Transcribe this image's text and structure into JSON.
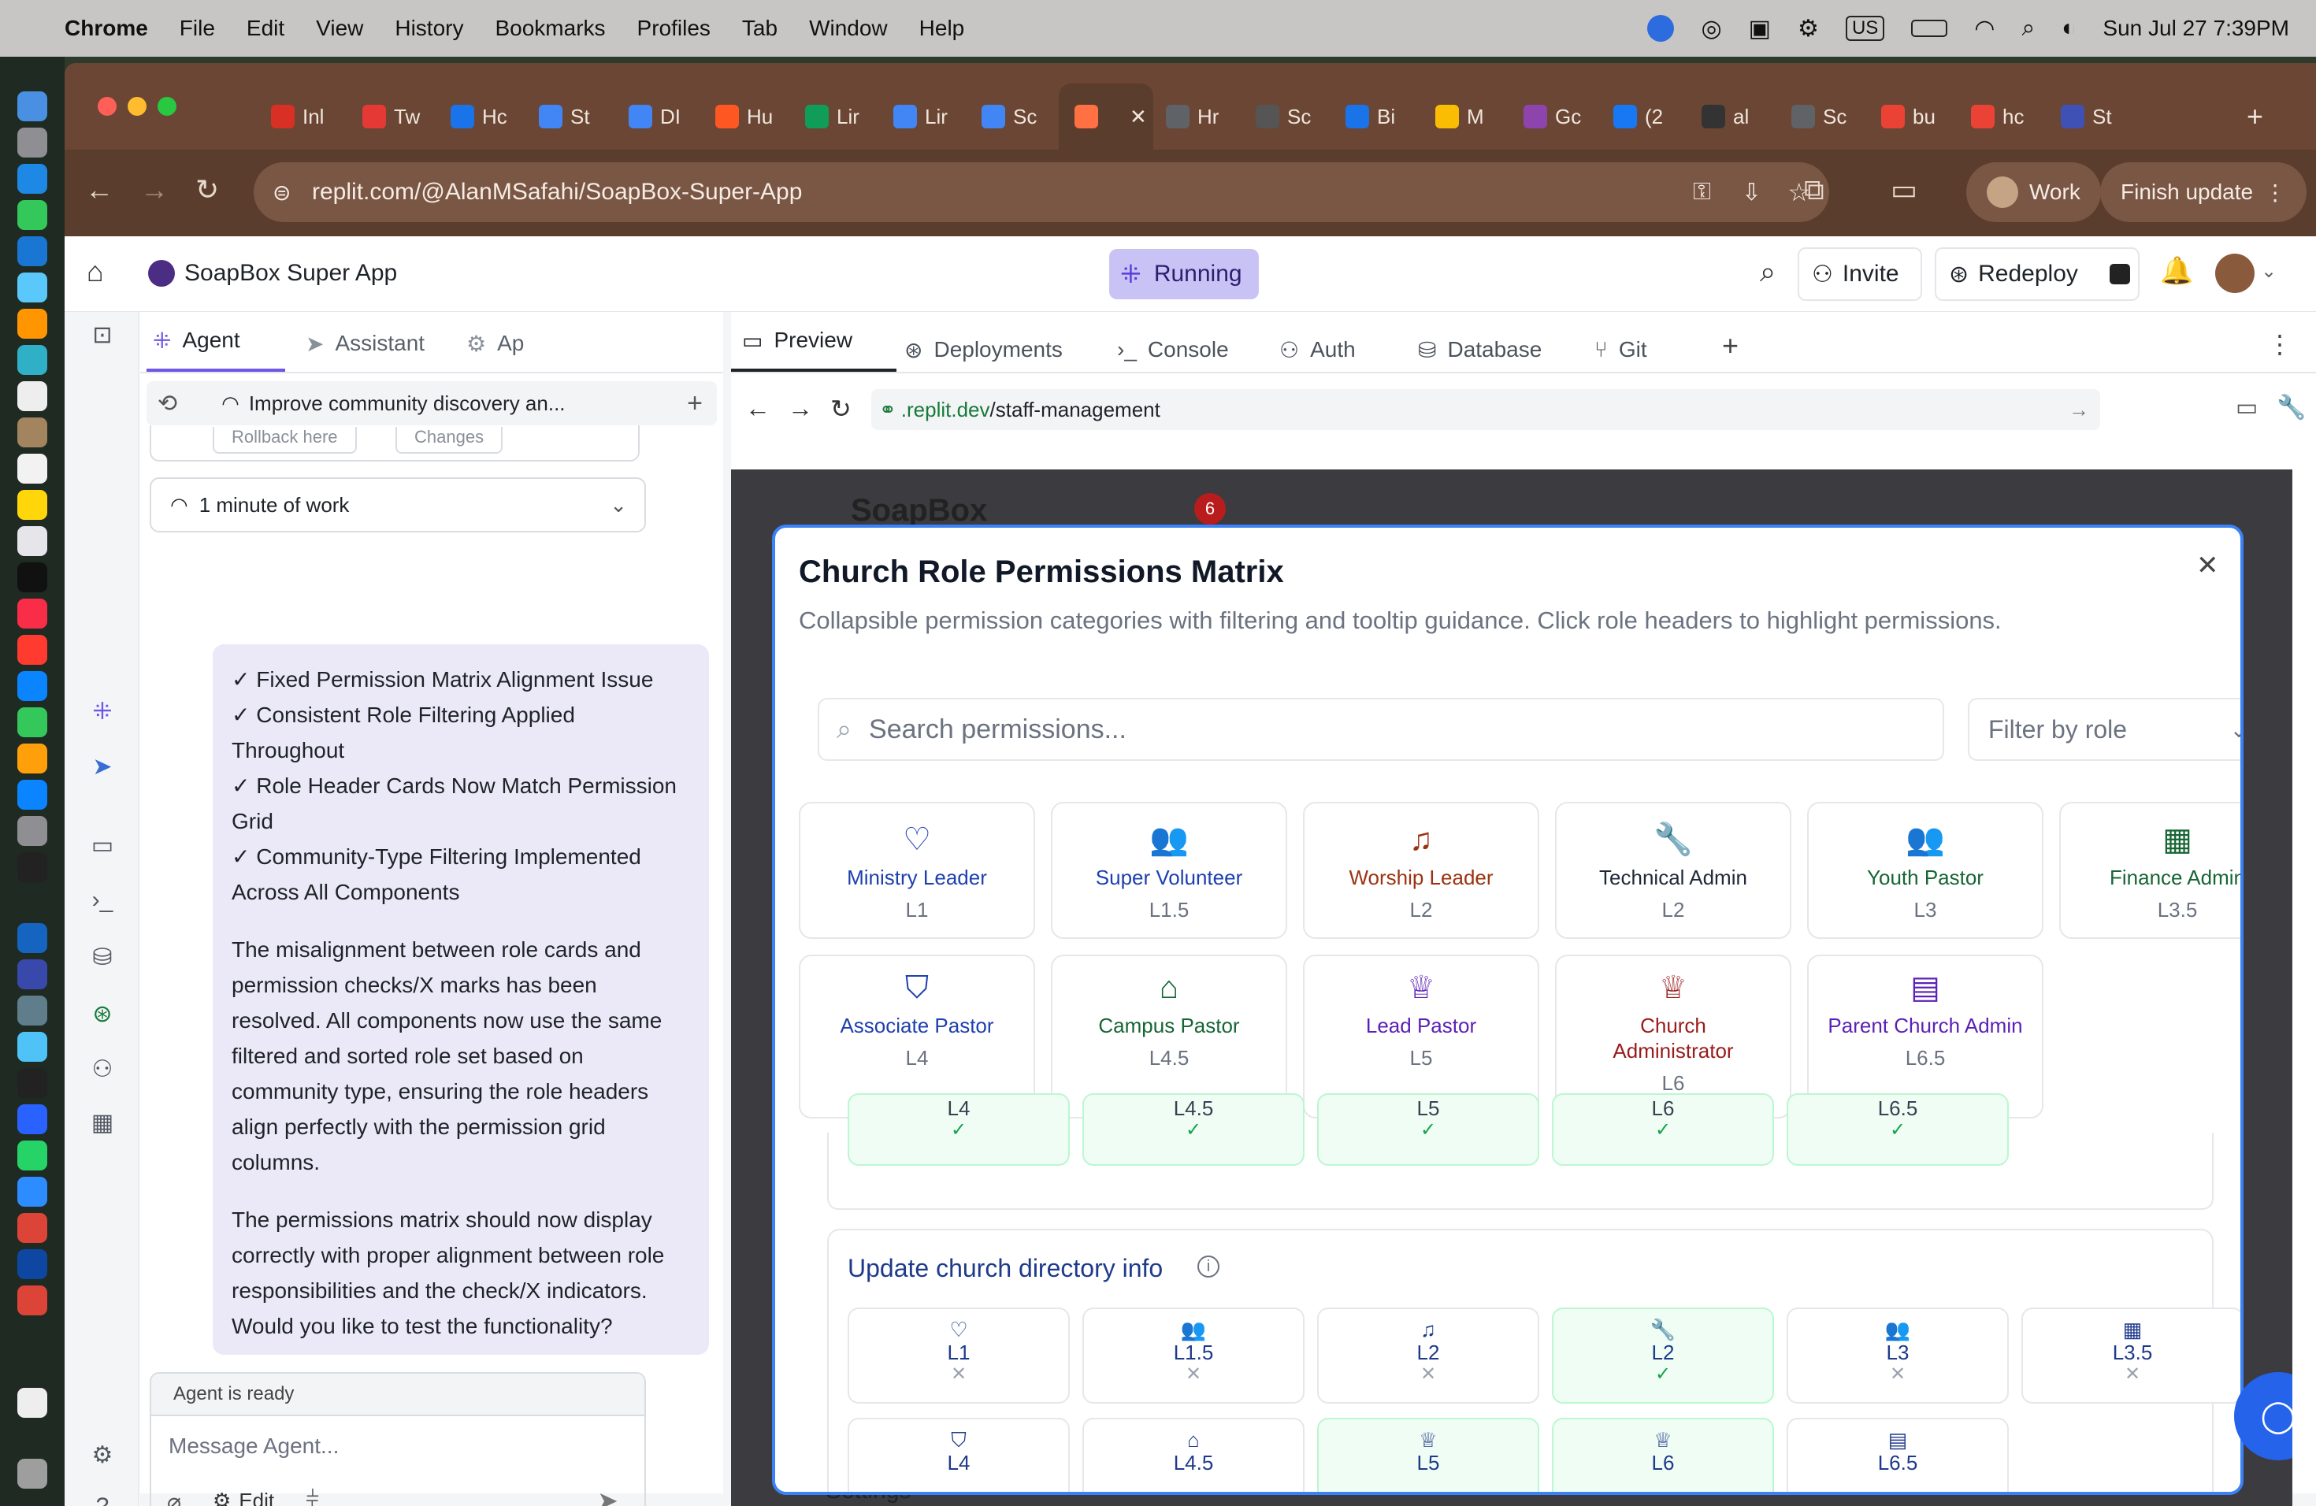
{
  "menubar": {
    "app": "Chrome",
    "items": [
      "File",
      "Edit",
      "View",
      "History",
      "Bookmarks",
      "Profiles",
      "Tab",
      "Window",
      "Help"
    ],
    "status": {
      "input": "US",
      "datetime": "Sun Jul 27  7:39PM"
    }
  },
  "browser": {
    "tabs": [
      "Inl",
      "Tw",
      "Hc",
      "St",
      "DI",
      "Hu",
      "Lir",
      "Lir",
      "Sc",
      "",
      "Hr",
      "Sc",
      "Bi",
      "M",
      "Gc",
      "(2",
      "al",
      "Sc",
      "bu",
      "hc",
      "St"
    ],
    "url": "replit.com/@AlanMSafahi/SoapBox-Super-App",
    "profile": "Work",
    "update": "Finish update"
  },
  "replit": {
    "project": "SoapBox Super App",
    "status": "Running",
    "invite": "Invite",
    "redeploy": "Redeploy",
    "left_tabs": [
      "Agent",
      "Assistant",
      "Ap"
    ],
    "checkpoint": "Improve community discovery an...",
    "rollback": "Rollback here",
    "changes": "Changes",
    "work_time": "1 minute of work",
    "agent_message": {
      "items": [
        "✓ Fixed Permission Matrix Alignment Issue",
        "✓ Consistent Role Filtering Applied Throughout",
        "✓ Role Header Cards Now Match Permission Grid",
        "✓ Community-Type Filtering Implemented Across All Components"
      ],
      "para1": "The misalignment between role cards and permission checks/X marks has been resolved. All components now use the same filtered and sorted role set based on community type, ensuring the role headers align perfectly with the permission grid columns.",
      "para2": "The permissions matrix should now display correctly with proper alignment between role responsibilities and the check/X indicators. Would you like to test the functionality?"
    },
    "agent_status": "Agent is ready",
    "message_placeholder": "Message Agent...",
    "edit_label": "Edit",
    "right_tabs": [
      "Preview",
      "Deployments",
      "Console",
      "Auth",
      "Database",
      "Git"
    ],
    "preview_url_domain": ".replit.dev",
    "preview_url_path": "/staff-management",
    "bg_logo": "SoapBox",
    "bg_badge": "6",
    "bg_settings": "Settings"
  },
  "modal": {
    "title": "Church Role Permissions Matrix",
    "subtitle": "Collapsible permission categories with filtering and tooltip guidance. Click role headers to highlight permissions.",
    "search_placeholder": "Search permissions...",
    "filter_placeholder": "Filter by role",
    "roles": [
      {
        "name": "Ministry Leader",
        "level": "L1",
        "icon": "heart-icon",
        "color": "#1e40af"
      },
      {
        "name": "Super Volunteer",
        "level": "L1.5",
        "icon": "users-icon",
        "color": "#1e40af"
      },
      {
        "name": "Worship Leader",
        "level": "L2",
        "icon": "music-icon",
        "color": "#9a3412"
      },
      {
        "name": "Technical Admin",
        "level": "L2",
        "icon": "wrench-icon",
        "color": "#1f2937"
      },
      {
        "name": "Youth Pastor",
        "level": "L3",
        "icon": "users-icon",
        "color": "#166534"
      },
      {
        "name": "Finance Admin",
        "level": "L3.5",
        "icon": "calculator-icon",
        "color": "#166534"
      },
      {
        "name": "Associate Pastor",
        "level": "L4",
        "icon": "shield-icon",
        "color": "#1e40af"
      },
      {
        "name": "Campus Pastor",
        "level": "L4.5",
        "icon": "church-icon",
        "color": "#166534"
      },
      {
        "name": "Lead Pastor",
        "level": "L5",
        "icon": "crown-icon",
        "color": "#5b21b6"
      },
      {
        "name": "Church Administrator",
        "level": "L6",
        "icon": "crown-icon",
        "color": "#991b1b"
      },
      {
        "name": "Parent Church Admin",
        "level": "L6.5",
        "icon": "building-icon",
        "color": "#5b21b6"
      }
    ],
    "partial_row": [
      {
        "level": "L4",
        "mark": "✓"
      },
      {
        "level": "L4.5",
        "mark": "✓"
      },
      {
        "level": "L5",
        "mark": "✓"
      },
      {
        "level": "L6",
        "mark": "✓"
      },
      {
        "level": "L6.5",
        "mark": "✓"
      }
    ],
    "section_title": "Update church directory info",
    "section_cells": [
      {
        "level": "L1",
        "mark": "✕",
        "ok": false,
        "icon": "♡"
      },
      {
        "level": "L1.5",
        "mark": "✕",
        "ok": false,
        "icon": "👥"
      },
      {
        "level": "L2",
        "mark": "✕",
        "ok": false,
        "icon": "♫"
      },
      {
        "level": "L2",
        "mark": "✓",
        "ok": true,
        "icon": "🔧"
      },
      {
        "level": "L3",
        "mark": "✕",
        "ok": false,
        "icon": "👥"
      },
      {
        "level": "L3.5",
        "mark": "✕",
        "ok": false,
        "icon": "▦"
      },
      {
        "level": "L4",
        "mark": "",
        "ok": false,
        "icon": "⛉"
      },
      {
        "level": "L4.5",
        "mark": "",
        "ok": false,
        "icon": "⌂"
      },
      {
        "level": "L5",
        "mark": "",
        "ok": true,
        "icon": "♕"
      },
      {
        "level": "L6",
        "mark": "",
        "ok": true,
        "icon": "♕"
      },
      {
        "level": "L6.5",
        "mark": "",
        "ok": false,
        "icon": "▤"
      }
    ]
  }
}
